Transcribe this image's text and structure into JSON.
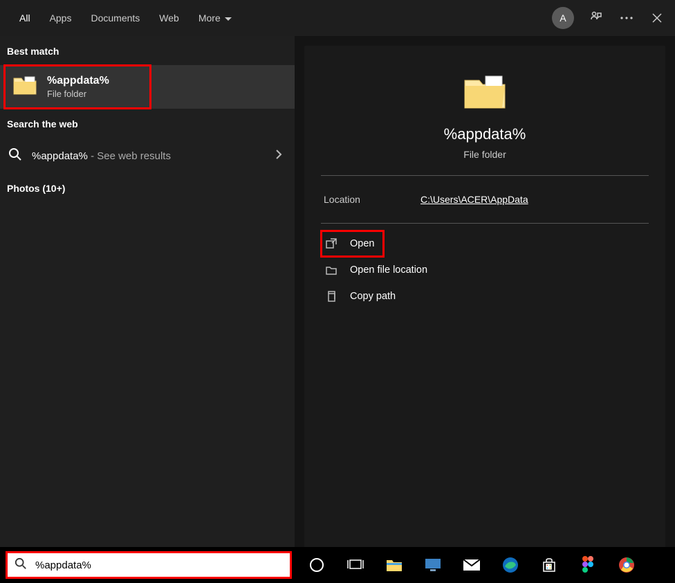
{
  "tabs": {
    "all": "All",
    "apps": "Apps",
    "documents": "Documents",
    "web": "Web",
    "more": "More"
  },
  "avatar_letter": "A",
  "left": {
    "best_match_label": "Best match",
    "result_title": "%appdata%",
    "result_sub": "File folder",
    "search_web_label": "Search the web",
    "web_term": "%appdata%",
    "web_sub": " - See web results",
    "photos_label": "Photos (10+)"
  },
  "preview": {
    "title": "%appdata%",
    "sub": "File folder",
    "location_label": "Location",
    "location_value": "C:\\Users\\ACER\\AppData",
    "actions": {
      "open": "Open",
      "open_location": "Open file location",
      "copy_path": "Copy path"
    }
  },
  "search_input": "%appdata%"
}
